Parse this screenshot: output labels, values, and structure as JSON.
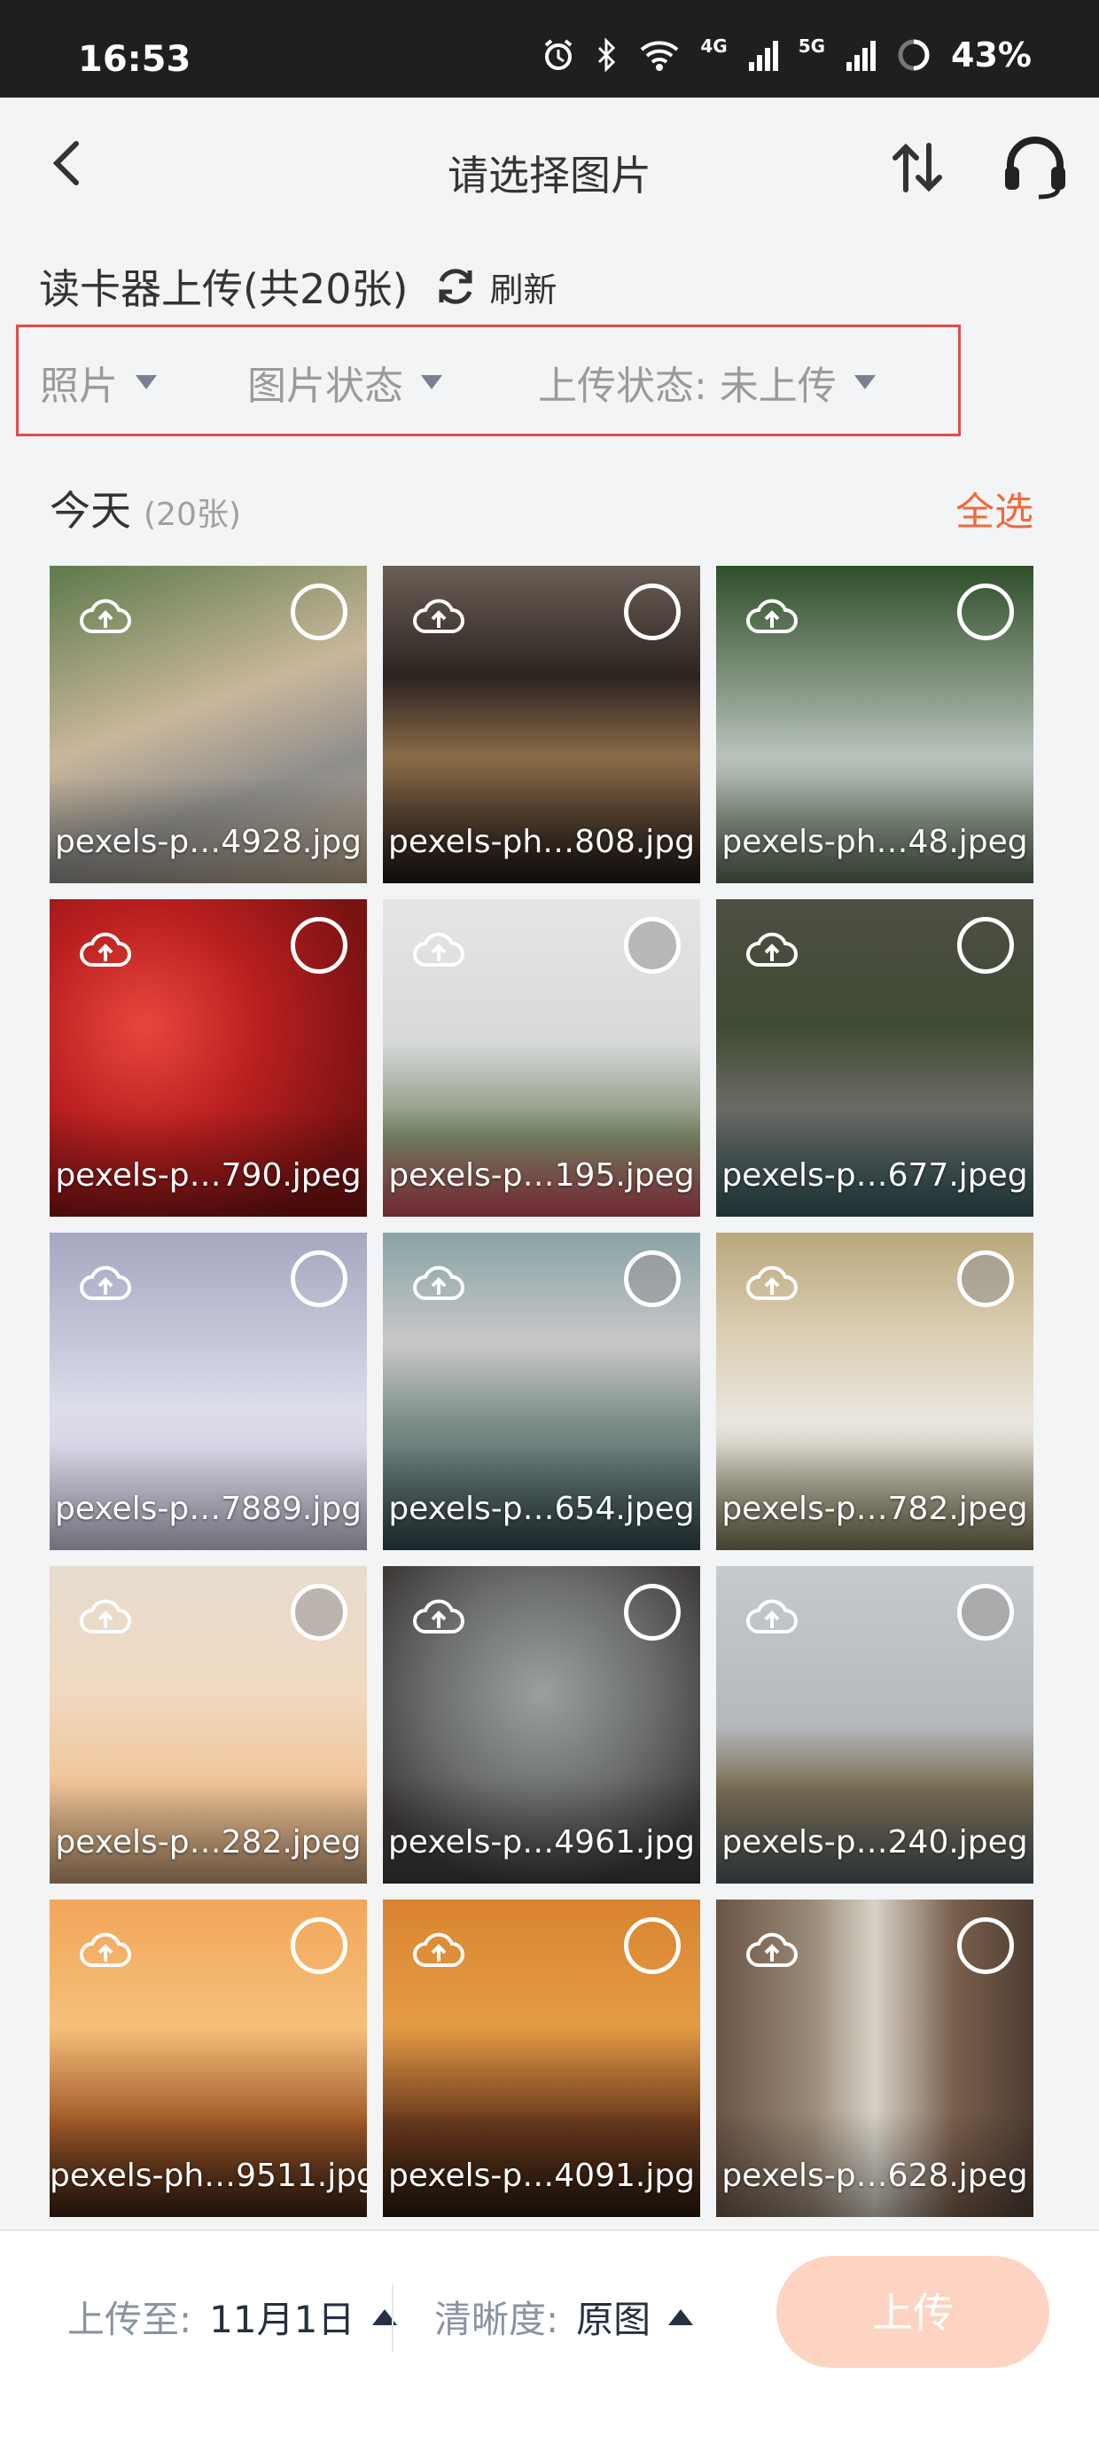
{
  "status_bar": {
    "time": "16:53",
    "battery": "43%",
    "net_4g": "4G",
    "net_5g": "5G"
  },
  "header": {
    "title": "请选择图片"
  },
  "source": {
    "title": "读卡器上传(共20张)",
    "refresh_label": "刷新"
  },
  "filters": {
    "type": "照片",
    "image_status": "图片状态",
    "upload_status": "上传状态: 未上传"
  },
  "section": {
    "label": "今天",
    "count": "(20张)",
    "select_all": "全选"
  },
  "photos": [
    {
      "name": "pexels-p…4928.jpg",
      "selected": false
    },
    {
      "name": "pexels-ph…808.jpg",
      "selected": false
    },
    {
      "name": "pexels-ph…48.jpeg",
      "selected": false
    },
    {
      "name": "pexels-p…790.jpeg",
      "selected": false
    },
    {
      "name": "pexels-p…195.jpeg",
      "selected": false
    },
    {
      "name": "pexels-p…677.jpeg",
      "selected": false
    },
    {
      "name": "pexels-p…7889.jpg",
      "selected": false
    },
    {
      "name": "pexels-p…654.jpeg",
      "selected": false
    },
    {
      "name": "pexels-p…782.jpeg",
      "selected": false
    },
    {
      "name": "pexels-p…282.jpeg",
      "selected": false
    },
    {
      "name": "pexels-p…4961.jpg",
      "selected": false
    },
    {
      "name": "pexels-p…240.jpeg",
      "selected": false
    },
    {
      "name": "pexels-ph…9511.jpg",
      "selected": false
    },
    {
      "name": "pexels-p…4091.jpg",
      "selected": false
    },
    {
      "name": "pexels-p…628.jpeg",
      "selected": false
    }
  ],
  "bottom": {
    "upload_to_label": "上传至:",
    "upload_to_value": "11月1日",
    "clarity_label": "清晰度:",
    "clarity_value": "原图",
    "upload_button": "上传"
  },
  "colors": {
    "accent": "#f06a3c",
    "upload_button_disabled": "#fdd3c2",
    "filter_highlight_border": "#e64a4a"
  }
}
